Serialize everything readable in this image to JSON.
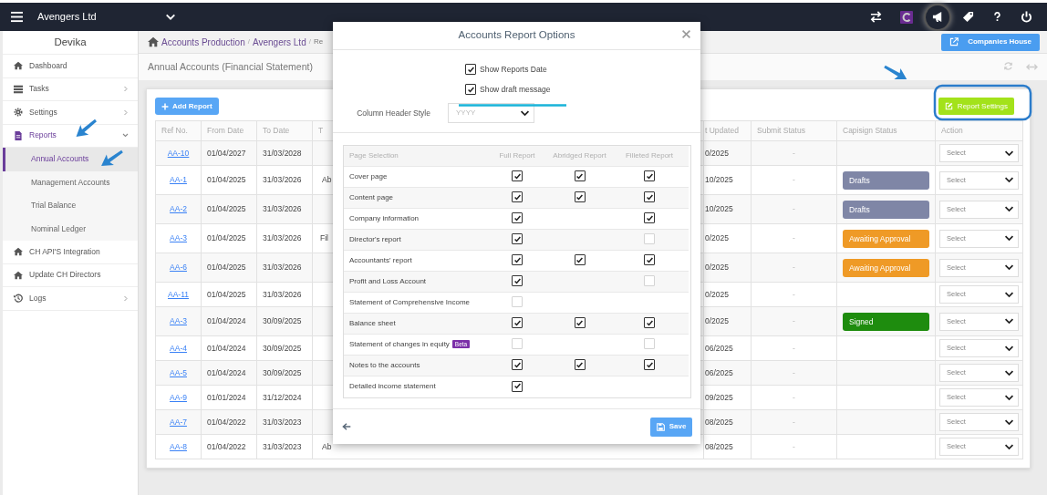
{
  "topbar": {
    "company": "Avengers Ltd"
  },
  "sidebar": {
    "user": "Devika",
    "items": [
      {
        "label": "Dashboard",
        "active": false
      },
      {
        "label": "Tasks",
        "active": false,
        "expanded": false
      },
      {
        "label": "Settings",
        "active": false,
        "expanded": false
      },
      {
        "label": "Reports",
        "active": true,
        "expanded": true,
        "children": [
          {
            "label": "Annual Accounts",
            "selected": true
          },
          {
            "label": "Management Accounts",
            "selected": false
          },
          {
            "label": "Trial Balance",
            "selected": false
          },
          {
            "label": "Nominal Ledger",
            "selected": false
          }
        ]
      },
      {
        "label": "CH API'S Integration",
        "active": false
      },
      {
        "label": "Update CH Directors",
        "active": false
      },
      {
        "label": "Logs",
        "active": false,
        "expanded": false
      }
    ]
  },
  "breadcrumb": [
    {
      "label": "Accounts Production"
    },
    {
      "label": "Avengers Ltd",
      "separator": "/"
    },
    {
      "label": "Re",
      "separator": "/"
    }
  ],
  "companies_house_button": "Companies House",
  "page_title": "Annual Accounts (Financial Statement)",
  "add_report_button": "Add Report",
  "report_settings_button": "Report Settings",
  "table": {
    "columns": [
      "Ref No.",
      "From Date",
      "To Date",
      "T",
      "t Updated",
      "Submit Status",
      "Capisign Status",
      "Action"
    ],
    "rows": [
      {
        "ref": "AA-10",
        "from": "01/04/2027",
        "to": "31/03/2028",
        "updated": "0/2025",
        "submit": "-",
        "action": "Select"
      },
      {
        "ref": "AA-1",
        "from": "01/04/2025",
        "to": "31/03/2026",
        "type": "Ab",
        "updated": "10/2025",
        "submit": "-",
        "capisign": {
          "label": "Drafts",
          "color": "#7f86a6"
        },
        "action": "Select"
      },
      {
        "ref": "AA-2",
        "from": "01/04/2025",
        "to": "31/03/2026",
        "updated": "10/2025",
        "submit": "-",
        "capisign": {
          "label": "Drafts",
          "color": "#7f86a6"
        },
        "action": "Select"
      },
      {
        "ref": "AA-3",
        "from": "01/04/2025",
        "to": "31/03/2026",
        "type": "Fil",
        "updated": "0/2025",
        "submit": "-",
        "capisign": {
          "label": "Awaiting Approval",
          "color": "#ef9a26"
        },
        "action": "Select"
      },
      {
        "ref": "AA-6",
        "from": "01/04/2025",
        "to": "31/03/2026",
        "updated": "0/2025",
        "submit": "-",
        "capisign": {
          "label": "Awaiting Approval",
          "color": "#ef9a26"
        },
        "action": "Select"
      },
      {
        "ref": "AA-11",
        "from": "01/04/2025",
        "to": "31/03/2026",
        "updated": "0/2025",
        "submit": "-",
        "action": "Select"
      },
      {
        "ref": "AA-3",
        "from": "01/04/2024",
        "to": "30/09/2025",
        "updated": "0/2025",
        "submit": "-",
        "capisign": {
          "label": "Signed",
          "color": "#1e8c0e"
        },
        "action": "Select"
      },
      {
        "ref": "AA-4",
        "from": "01/04/2024",
        "to": "30/09/2025",
        "updated": "06/2025",
        "submit": "-",
        "action": "Select"
      },
      {
        "ref": "AA-5",
        "from": "01/04/2024",
        "to": "30/09/2025",
        "updated": "06/2025",
        "submit": "-",
        "action": "Select"
      },
      {
        "ref": "AA-9",
        "from": "01/01/2024",
        "to": "31/12/2024",
        "updated": "09/2025",
        "submit": "-",
        "action": "Select"
      },
      {
        "ref": "AA-7",
        "from": "01/04/2022",
        "to": "31/03/2023",
        "updated": "08/2025",
        "submit": "-",
        "action": "Select"
      },
      {
        "ref": "AA-8",
        "from": "01/04/2022",
        "to": "31/03/2023",
        "type": "Ab",
        "updated": "08/2025",
        "submit": "-",
        "action": "Select"
      }
    ]
  },
  "modal": {
    "title": "Accounts Report Options",
    "options": [
      {
        "label": "Show Reports Date",
        "checked": true
      },
      {
        "label": "Show draft message",
        "checked": true
      }
    ],
    "header_style": {
      "label": "Column Header Style",
      "placeholder": "YYYY"
    },
    "page_table": {
      "columns": [
        "Page Selection",
        "Full Report",
        "Abridged Report",
        "Filleted Report"
      ],
      "rows": [
        {
          "label": "Cover page",
          "full": {
            "checked": true
          },
          "abridged": {
            "checked": true
          },
          "filleted": {
            "checked": true
          }
        },
        {
          "label": "Content page",
          "full": {
            "checked": true
          },
          "abridged": {
            "checked": true
          },
          "filleted": {
            "checked": true
          }
        },
        {
          "label": "Company information",
          "full": {
            "checked": true
          },
          "filleted": {
            "checked": true
          }
        },
        {
          "label": "Director's report",
          "full": {
            "checked": true
          },
          "filleted": {
            "checked": false
          }
        },
        {
          "label": "Accountants' report",
          "full": {
            "checked": true
          },
          "abridged": {
            "checked": true
          },
          "filleted": {
            "checked": true
          }
        },
        {
          "label": "Profit and Loss Account",
          "full": {
            "checked": true
          },
          "filleted": {
            "checked": false
          }
        },
        {
          "label": "Statement of Comprehensive Income",
          "full": {
            "checked": false
          }
        },
        {
          "label": "Balance sheet",
          "full": {
            "checked": true
          },
          "abridged": {
            "checked": true
          },
          "filleted": {
            "checked": true
          }
        },
        {
          "label": "Statement of changes in equity",
          "badge": "Beta",
          "full": {
            "checked": false
          },
          "filleted": {
            "checked": false
          }
        },
        {
          "label": "Notes to the accounts",
          "full": {
            "checked": true
          },
          "abridged": {
            "checked": true
          },
          "filleted": {
            "checked": true
          }
        },
        {
          "label": "Detailed income statement",
          "full": {
            "checked": true
          }
        }
      ]
    },
    "save_button": "Save"
  }
}
